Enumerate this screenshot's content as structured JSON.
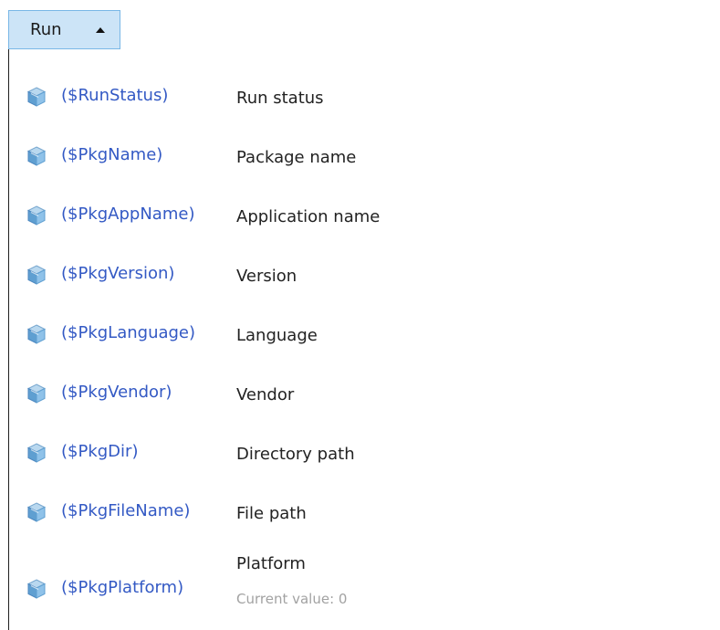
{
  "toolbar": {
    "run_label": "Run",
    "run_caret_icon": "caret-up-icon"
  },
  "variables": {
    "icon": "cube-icon",
    "items": [
      {
        "token": "($RunStatus)",
        "description": "Run status"
      },
      {
        "token": "($PkgName)",
        "description": "Package name"
      },
      {
        "token": "($PkgAppName)",
        "description": "Application name"
      },
      {
        "token": "($PkgVersion)",
        "description": "Version"
      },
      {
        "token": "($PkgLanguage)",
        "description": "Language"
      },
      {
        "token": "($PkgVendor)",
        "description": "Vendor"
      },
      {
        "token": "($PkgDir)",
        "description": "Directory path"
      },
      {
        "token": "($PkgFileName)",
        "description": "File path"
      },
      {
        "token": "($PkgPlatform)",
        "description": "Platform",
        "current_value": "Current value: 0"
      }
    ]
  },
  "colors": {
    "token": "#3359c4",
    "description": "#222222",
    "current_value": "#a2a2a2",
    "button_bg": "#cce4f7",
    "button_border": "#79b7e6"
  }
}
